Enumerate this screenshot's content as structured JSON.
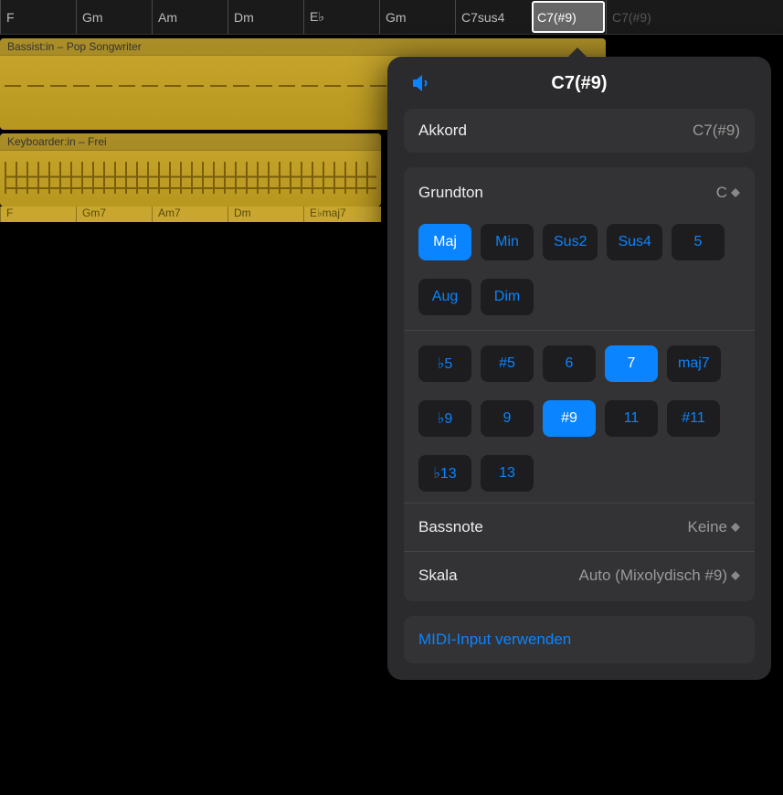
{
  "chord_track": {
    "cells": [
      {
        "label": "F",
        "selected": false
      },
      {
        "label": "Gm",
        "selected": false
      },
      {
        "label": "Am",
        "selected": false
      },
      {
        "label": "Dm",
        "selected": false
      },
      {
        "label": "E♭",
        "selected": false
      },
      {
        "label": "Gm",
        "selected": false
      },
      {
        "label": "C7sus4",
        "selected": false
      },
      {
        "label": "C7(#9)",
        "selected": true
      },
      {
        "label": "C7(#9)",
        "selected": false,
        "ghost": true
      }
    ]
  },
  "tracks": [
    {
      "label": "Bassist:in – Pop Songwriter"
    },
    {
      "label": "Keyboarder:in – Frei"
    }
  ],
  "region_chords": [
    {
      "label": "F"
    },
    {
      "label": "Gm7"
    },
    {
      "label": "Am7"
    },
    {
      "label": "Dm"
    },
    {
      "label": "E♭maj7"
    }
  ],
  "popover": {
    "title": "C7(#9)",
    "akkord": {
      "label": "Akkord",
      "value": "C7(#9)"
    },
    "grundton": {
      "label": "Grundton",
      "value": "C"
    },
    "quality": [
      {
        "label": "Maj",
        "selected": true
      },
      {
        "label": "Min",
        "selected": false
      },
      {
        "label": "Sus2",
        "selected": false
      },
      {
        "label": "Sus4",
        "selected": false
      },
      {
        "label": "5",
        "selected": false
      }
    ],
    "quality2": [
      {
        "label": "Aug",
        "selected": false
      },
      {
        "label": "Dim",
        "selected": false
      }
    ],
    "ext1": [
      {
        "label": "♭5",
        "selected": false
      },
      {
        "label": "#5",
        "selected": false
      },
      {
        "label": "6",
        "selected": false
      },
      {
        "label": "7",
        "selected": true
      },
      {
        "label": "maj7",
        "selected": false
      }
    ],
    "ext2": [
      {
        "label": "♭9",
        "selected": false
      },
      {
        "label": "9",
        "selected": false
      },
      {
        "label": "#9",
        "selected": true
      },
      {
        "label": "11",
        "selected": false
      },
      {
        "label": "#11",
        "selected": false
      }
    ],
    "ext3": [
      {
        "label": "♭13",
        "selected": false
      },
      {
        "label": "13",
        "selected": false
      }
    ],
    "bassnote": {
      "label": "Bassnote",
      "value": "Keine"
    },
    "skala": {
      "label": "Skala",
      "value": "Auto (Mixolydisch #9)"
    },
    "midi_button": "MIDI-Input verwenden"
  }
}
